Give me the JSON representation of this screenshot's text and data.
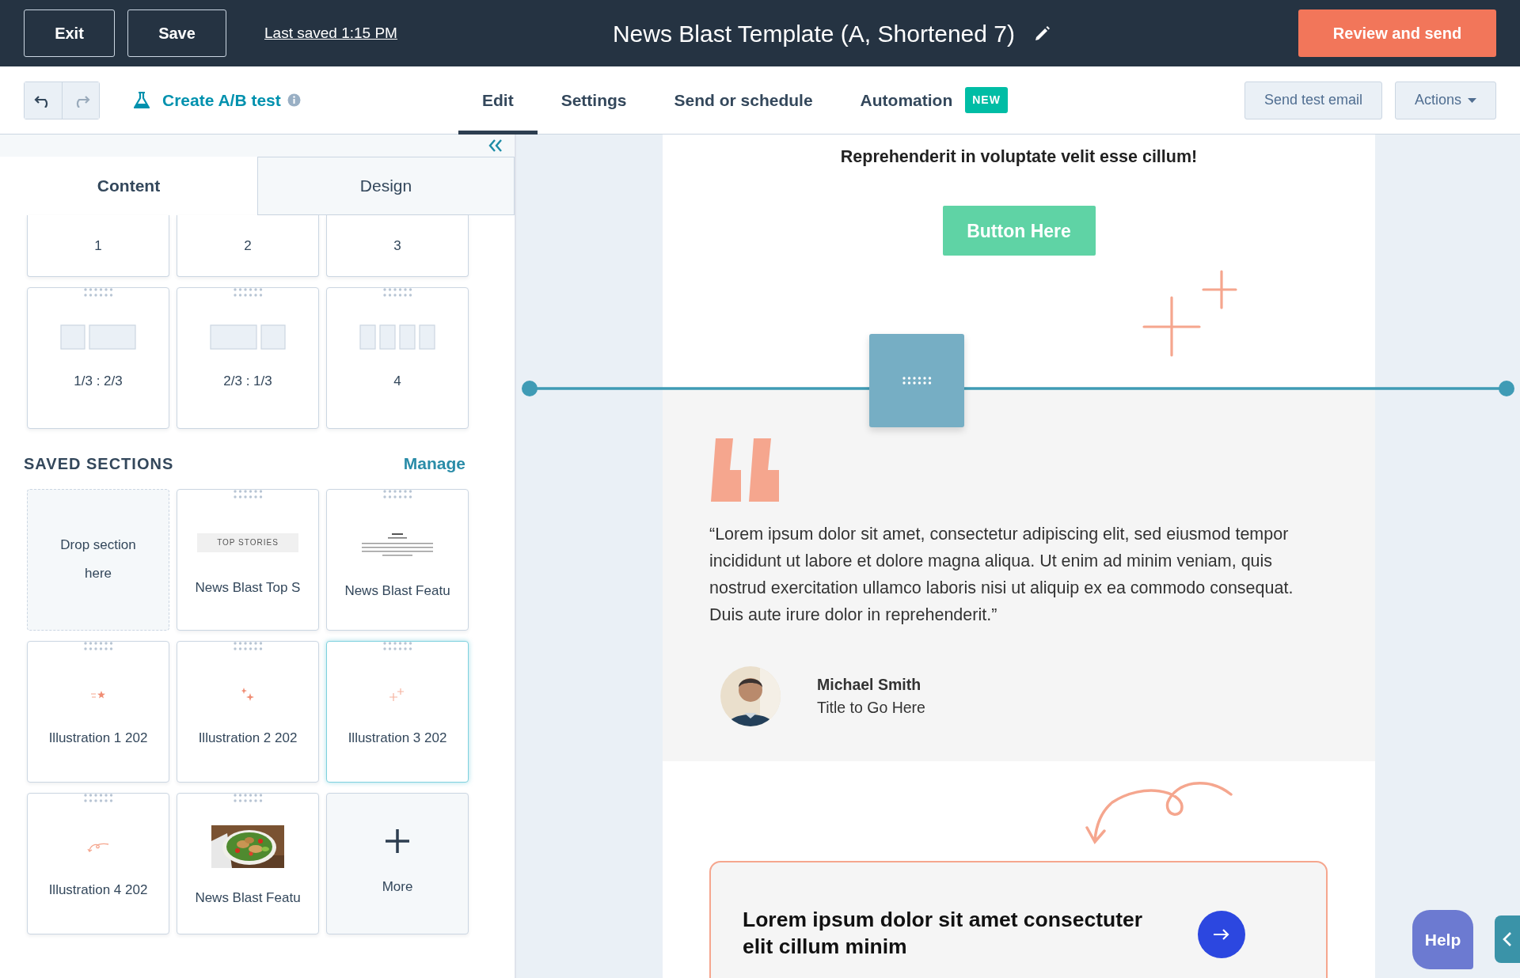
{
  "top_bar": {
    "exit": "Exit",
    "save": "Save",
    "last_saved": "Last saved 1:15 PM",
    "title": "News Blast Template (A, Shortened 7)",
    "review": "Review and send"
  },
  "toolbar": {
    "ab_test": "Create A/B test",
    "tabs": [
      {
        "label": "Edit",
        "selected": true
      },
      {
        "label": "Settings",
        "selected": false
      },
      {
        "label": "Send or schedule",
        "selected": false
      },
      {
        "label": "Automation",
        "selected": false,
        "badge": "NEW"
      }
    ],
    "send_test": "Send test email",
    "actions": "Actions"
  },
  "sidebar": {
    "tabs": [
      {
        "label": "Content",
        "selected": true
      },
      {
        "label": "Design",
        "selected": false
      }
    ],
    "layouts": [
      {
        "label": "1",
        "kind": "plain"
      },
      {
        "label": "2",
        "kind": "plain"
      },
      {
        "label": "3",
        "kind": "plain"
      },
      {
        "label": "1/3 : 2/3",
        "kind": "narrow-wide"
      },
      {
        "label": "2/3 : 1/3",
        "kind": "wide-narrow"
      },
      {
        "label": "4",
        "kind": "four"
      }
    ],
    "saved_title": "SAVED SECTIONS",
    "manage": "Manage",
    "saved": [
      {
        "kind": "drop",
        "label": "Drop section here",
        "selected": false
      },
      {
        "kind": "banner",
        "label": "News Blast Top S",
        "banner": "TOP STORIES",
        "selected": false
      },
      {
        "kind": "text-preview",
        "label": "News Blast Featu",
        "selected": false
      },
      {
        "kind": "star-burst",
        "label": "Illustration 1 202",
        "selected": false
      },
      {
        "kind": "sparkles",
        "label": "Illustration 2 202",
        "selected": false
      },
      {
        "kind": "sparkle-pair",
        "label": "Illustration 3 202",
        "selected": true
      },
      {
        "kind": "swirl",
        "label": "Illustration 4 202",
        "selected": false
      },
      {
        "label": "News Blast Featu",
        "selected": false
      },
      {
        "kind": "more",
        "label": "More",
        "selected": false
      }
    ]
  },
  "email": {
    "heading": "Reprehenderit in voluptate velit esse cillum!",
    "button": "Button Here",
    "quote": "“Lorem ipsum dolor sit amet, consectetur adipiscing elit, sed eiusmod tempor incididunt ut labore et dolore magna aliqua. Ut enim ad minim veniam, quis nostrud exercitation ullamco laboris nisi ut aliquip ex ea commodo consequat. Duis aute irure dolor in reprehenderit.”",
    "author": {
      "name": "Michael Smith",
      "title": "Title to Go Here"
    },
    "cta": "Lorem ipsum dolor sit amet consectuter elit cillum minim"
  },
  "help": "Help"
}
